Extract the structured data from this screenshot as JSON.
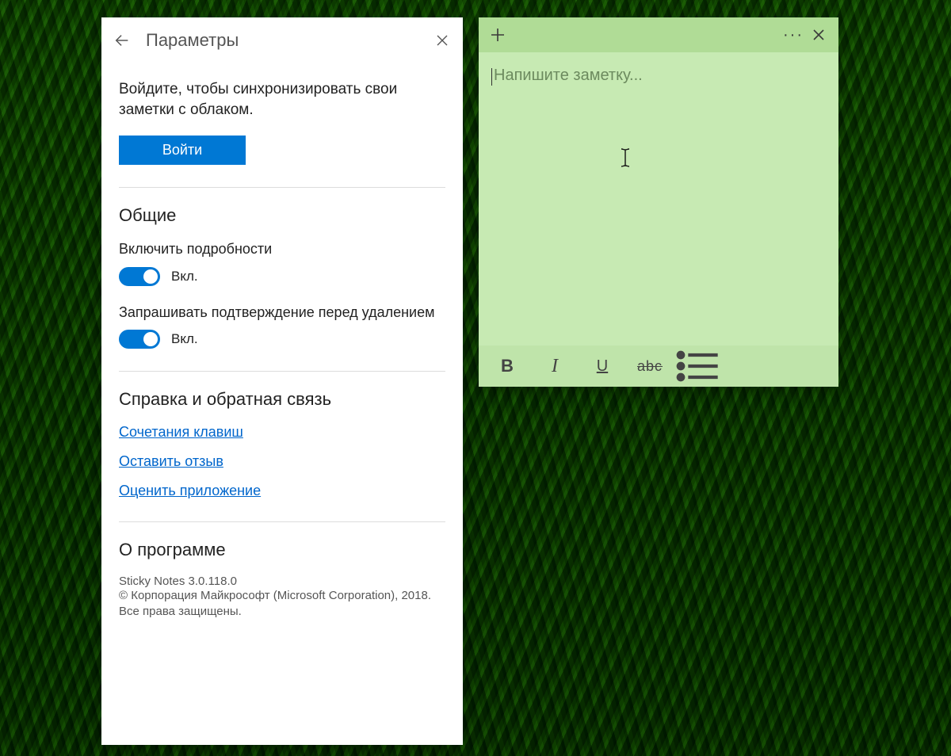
{
  "settings": {
    "title": "Параметры",
    "sync_prompt": "Войдите, чтобы синхронизировать свои заметки с облаком.",
    "signin_label": "Войти",
    "general_heading": "Общие",
    "insights_label": "Включить подробности",
    "insights_state": "Вкл.",
    "confirm_delete_label": "Запрашивать подтверждение перед удалением",
    "confirm_delete_state": "Вкл.",
    "help_heading": "Справка и обратная связь",
    "link_shortcuts": "Сочетания клавиш",
    "link_feedback": "Оставить отзыв",
    "link_rate": "Оценить приложение",
    "about_heading": "О программе",
    "about_version": "Sticky Notes 3.0.118.0",
    "about_copyright": "© Корпорация Майкрософт (Microsoft Corporation), 2018. Все права защищены."
  },
  "note": {
    "placeholder": "Напишите заметку...",
    "formatting": {
      "bold": "B",
      "italic": "I",
      "underline": "U",
      "strike": "abc"
    }
  },
  "colors": {
    "accent": "#0078d4",
    "note_bg": "#c7eab3",
    "note_header": "#b0dc96",
    "note_toolbar": "#bfe4aa"
  }
}
